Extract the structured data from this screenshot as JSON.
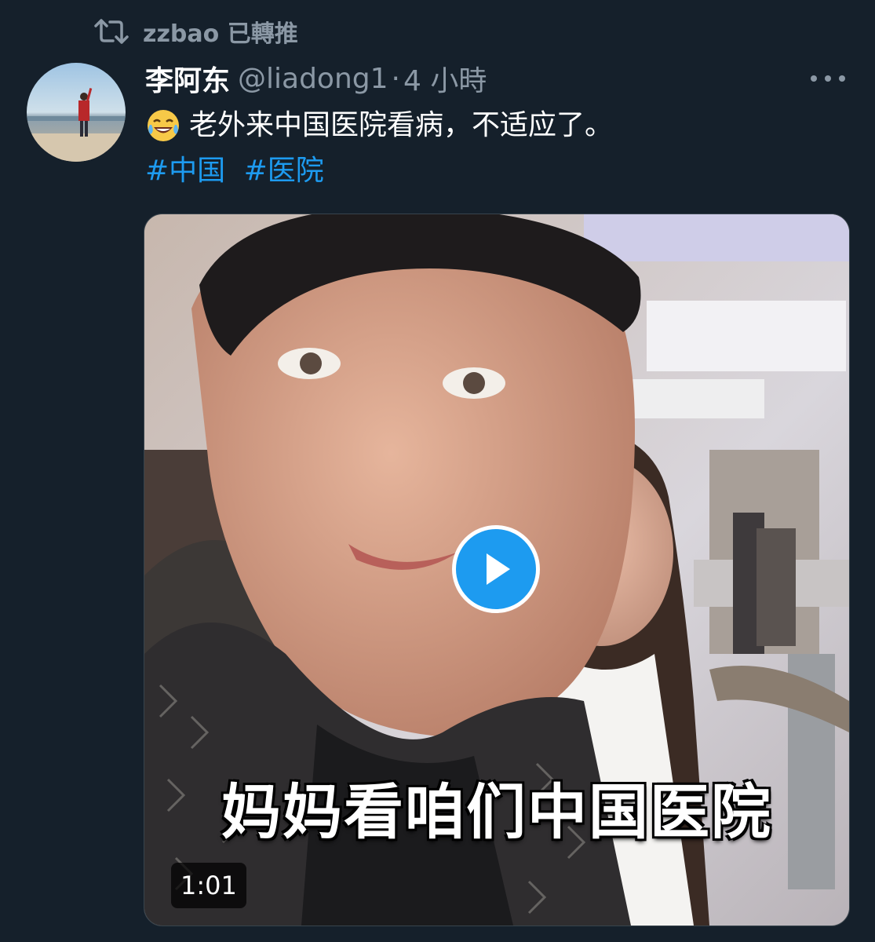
{
  "retweet": {
    "label": "zzbao 已轉推",
    "icon": "retweet-icon"
  },
  "author": {
    "display_name": "李阿东",
    "handle": "@liadong1",
    "separator": "·",
    "time": "4 小時"
  },
  "more": {
    "icon": "more-icon"
  },
  "tweet": {
    "emoji": "laughing-tears-emoji",
    "text": "老外来中国医院看病，不适应了。",
    "hashtags": [
      "#中国",
      "#医院"
    ]
  },
  "media": {
    "caption": "妈妈看咱们中国医院",
    "duration": "1:01",
    "play_icon": "play-icon"
  },
  "colors": {
    "background": "#15202b",
    "accent": "#1d9bf0",
    "secondary_text": "#8b98a5"
  }
}
